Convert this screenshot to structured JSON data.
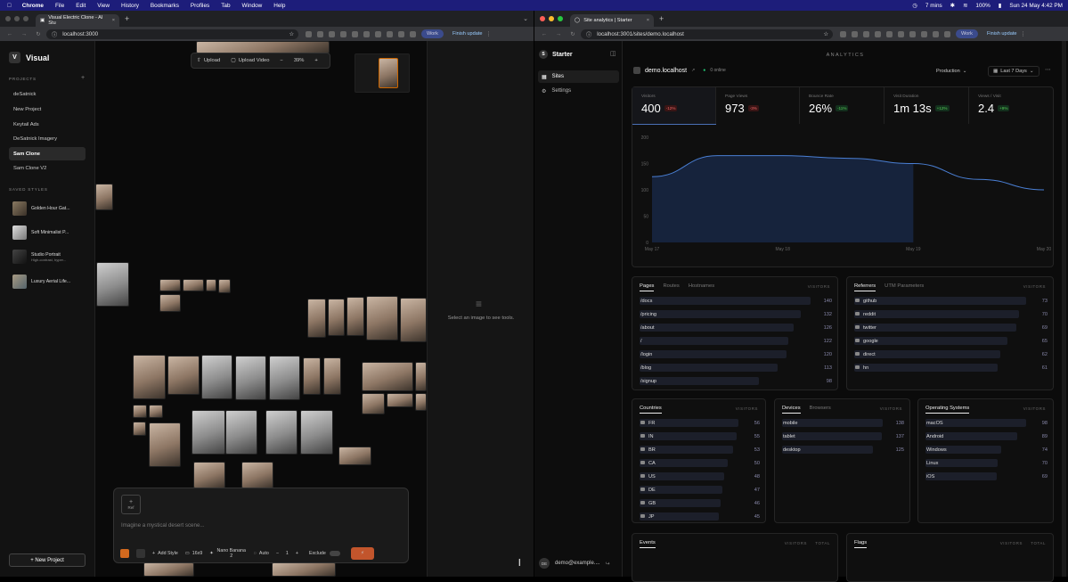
{
  "menubar": {
    "apple": "",
    "app": "Chrome",
    "items": [
      "File",
      "Edit",
      "View",
      "History",
      "Bookmarks",
      "Profiles",
      "Tab",
      "Window",
      "Help"
    ],
    "timer": "7 mins",
    "battery": "100%",
    "datetime": "Sun 24 May  4:42 PM"
  },
  "left": {
    "tab_title": "Visual Electric Clone - AI Stu",
    "url": "localhost:3000",
    "work": "Work",
    "finish": "Finish update",
    "logo": "Visual",
    "logo_letter": "V",
    "projects_label": "PROJECTS",
    "projects": [
      "deSatnick",
      "New Project",
      "Keytail Ads",
      "DeSatnick Imagery",
      "Sam Clone",
      "Sam Clone V2"
    ],
    "saved_styles_label": "SAVED STYLES",
    "styles": [
      {
        "name": "Golden Hour Gat..."
      },
      {
        "name": "Soft Minimalist P..."
      },
      {
        "name": "Studio Portrait",
        "sub": "High-contrast, hyper..."
      },
      {
        "name": "Luxury Aerial Life..."
      }
    ],
    "new_project": "+ New Project",
    "toolbar": {
      "upload": "Upload",
      "upload_video": "Upload Video",
      "zoom": "39%"
    },
    "panel_hint": "Select an image to see tools.",
    "prompt": {
      "placeholder": "Imagine a mystical desert scene...",
      "ref": "Ref",
      "add_style": "Add Style",
      "ratio": "16x9",
      "model": "Nano Banana 2",
      "auto": "Auto",
      "count": "1",
      "exclude": "Exclude"
    }
  },
  "right": {
    "tab_title": "Site analytics | Starter",
    "url": "localhost:3001/sites/demo.localhost",
    "work": "Work",
    "finish": "Finish update",
    "brand": "Starter",
    "brand_letter": "S",
    "nav": [
      "Sites",
      "Settings"
    ],
    "user": "demo@example....",
    "user_initials": "DE",
    "page_label": "ANALYTICS",
    "site": "demo.localhost",
    "online": "0 online",
    "env": "Production",
    "range": "Last 7 Days",
    "stats": [
      {
        "label": "Visitors",
        "value": "400",
        "delta": "-12%",
        "dir": "down"
      },
      {
        "label": "Page Views",
        "value": "973",
        "delta": "-3%",
        "dir": "down"
      },
      {
        "label": "Bounce Rate",
        "value": "26%",
        "delta": "-11%",
        "dir": "up"
      },
      {
        "label": "Visit Duration",
        "value": "1m 13s",
        "delta": "+12%",
        "dir": "up"
      },
      {
        "label": "Views / Visit",
        "value": "2.4",
        "delta": "+9%",
        "dir": "up"
      }
    ],
    "chart_data": {
      "type": "area",
      "x": [
        "May 17",
        "May 18",
        "May 19",
        "May 20"
      ],
      "yticks": [
        0,
        50,
        100,
        150,
        200
      ],
      "ylim": [
        0,
        200
      ],
      "series": [
        {
          "values": [
            [
              0,
              125
            ],
            [
              0.5,
              165
            ],
            [
              1.0,
              165
            ],
            [
              1.5,
              160
            ],
            [
              2.0,
              150
            ],
            [
              2.5,
              120
            ],
            [
              3.0,
              100
            ]
          ]
        }
      ]
    },
    "pages": {
      "tabs": [
        "Pages",
        "Routes",
        "Hostnames"
      ],
      "col": "VISITORS",
      "rows": [
        [
          "/docs",
          140
        ],
        [
          "/pricing",
          132
        ],
        [
          "/about",
          126
        ],
        [
          "/",
          122
        ],
        [
          "/login",
          120
        ],
        [
          "/blog",
          113
        ],
        [
          "/signup",
          98
        ]
      ]
    },
    "referrers": {
      "tabs": [
        "Referrers",
        "UTM Parameters"
      ],
      "col": "VISITORS",
      "rows": [
        [
          "github",
          73
        ],
        [
          "reddit",
          70
        ],
        [
          "twitter",
          69
        ],
        [
          "google",
          65
        ],
        [
          "direct",
          62
        ],
        [
          "hn",
          61
        ]
      ]
    },
    "countries": {
      "tabs": [
        "Countries"
      ],
      "col": "VISITORS",
      "rows": [
        [
          "FR",
          56
        ],
        [
          "IN",
          55
        ],
        [
          "BR",
          53
        ],
        [
          "CA",
          50
        ],
        [
          "US",
          48
        ],
        [
          "DE",
          47
        ],
        [
          "GB",
          46
        ],
        [
          "JP",
          45
        ]
      ]
    },
    "devices": {
      "tabs": [
        "Devices",
        "Browsers"
      ],
      "col": "VISITORS",
      "rows": [
        [
          "mobile",
          138
        ],
        [
          "tablet",
          137
        ],
        [
          "desktop",
          125
        ]
      ]
    },
    "os": {
      "tabs": [
        "Operating Systems"
      ],
      "col": "VISITORS",
      "rows": [
        [
          "macOS",
          98
        ],
        [
          "Android",
          89
        ],
        [
          "Windows",
          74
        ],
        [
          "Linux",
          70
        ],
        [
          "iOS",
          69
        ]
      ]
    },
    "events": {
      "title": "Events",
      "cols": [
        "VISITORS",
        "TOTAL"
      ]
    },
    "flags": {
      "title": "Flags",
      "cols": [
        "VISITORS",
        "TOTAL"
      ]
    }
  }
}
